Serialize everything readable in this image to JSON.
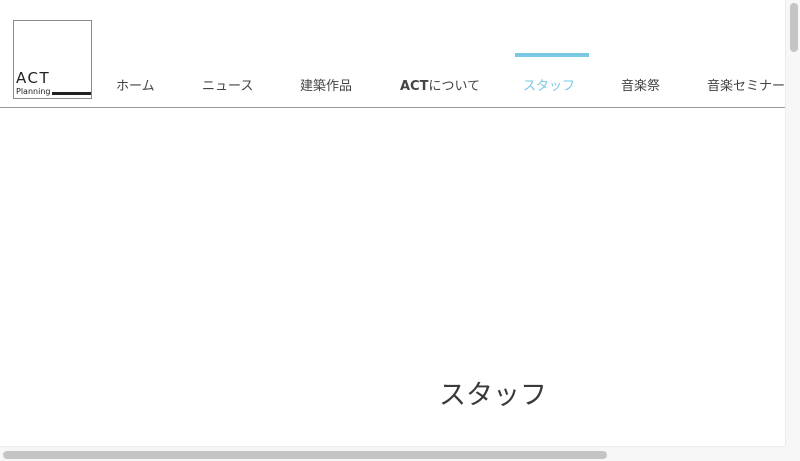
{
  "logo": {
    "main": "ACT",
    "sub": "Planning"
  },
  "nav": {
    "items": [
      {
        "label": "ホーム"
      },
      {
        "label": "ニュース"
      },
      {
        "label": "建築作品"
      },
      {
        "label_bold": "ACT",
        "label_suffix": "について"
      },
      {
        "label": "スタッフ",
        "active": true
      },
      {
        "label": "音楽祭"
      },
      {
        "label": "音楽セミナー"
      }
    ]
  },
  "page": {
    "title": "スタッフ"
  },
  "colors": {
    "accent": "#7ac8e6",
    "text": "#444444",
    "rule": "#999999"
  }
}
